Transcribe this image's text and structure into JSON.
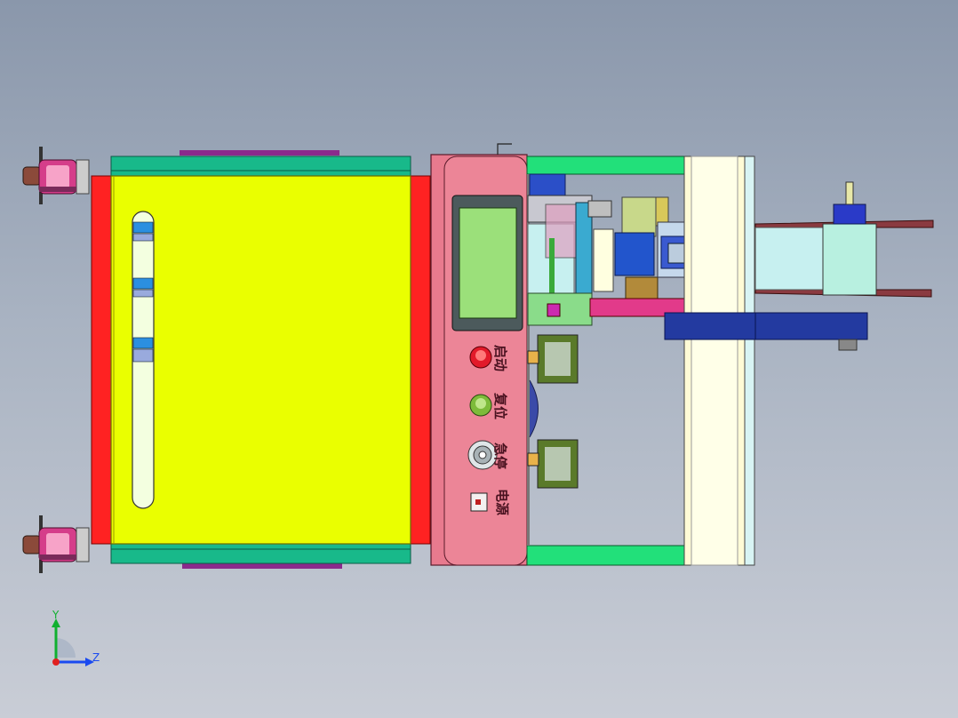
{
  "panel": {
    "labels": [
      "启动",
      "复位",
      "急停",
      "电源"
    ]
  },
  "triad": {
    "y_label": "Y",
    "z_label": "Z"
  },
  "colors": {
    "background_top": "#8a97ab",
    "background_bottom": "#c9cdd6",
    "tray": "#eaff00",
    "rail_red": "#ff2222",
    "rail_green": "#18b98a",
    "panel_pink": "#e87a8e",
    "screen": "#9be07a",
    "frame_green": "#22e07a",
    "conveyor": "#fffbd6",
    "navy": "#233aa0"
  },
  "icons": [
    "caster-wheel-icon",
    "start-button-icon",
    "reset-button-icon",
    "emergency-stop-icon",
    "power-switch-icon",
    "axis-triad-icon"
  ]
}
